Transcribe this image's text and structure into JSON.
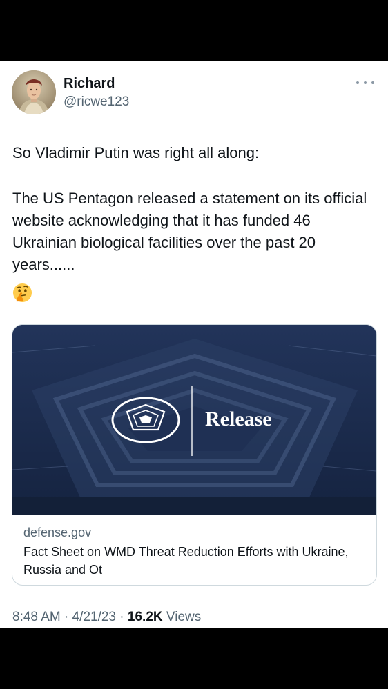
{
  "tweet": {
    "display_name": "Richard",
    "handle": "@ricwe123",
    "paragraph_1": "So Vladimir Putin was right all along:",
    "paragraph_2": "The US Pentagon released a statement on its official website acknowledging that it has funded 46 Ukrainian biological facilities over the past 20 years......",
    "emoji_icon": "thinking-face-icon",
    "more_icon": "more-options-icon"
  },
  "link_card": {
    "image_label": "Release",
    "domain": "defense.gov",
    "title": "Fact Sheet on WMD Threat Reduction Efforts with Ukraine, Russia and Ot"
  },
  "meta": {
    "time": "8:48 AM",
    "date": "4/21/23",
    "views_count": "16.2K",
    "views_label": "Views",
    "separator": "·"
  },
  "colors": {
    "text_primary": "#0f1419",
    "text_secondary": "#536471",
    "card_border": "#cfd9de",
    "card_image_bg": "#1c2b4a",
    "letterbox": "#000000"
  }
}
